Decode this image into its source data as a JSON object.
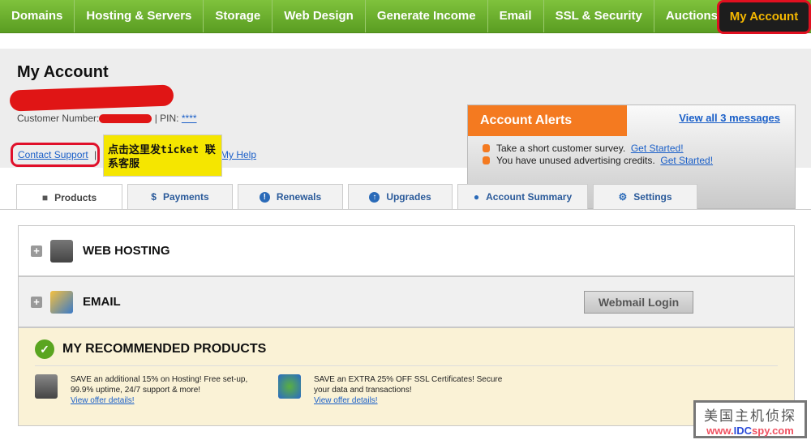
{
  "nav": {
    "items": [
      "Domains",
      "Hosting & Servers",
      "Storage",
      "Web Design",
      "Generate Income",
      "Email",
      "SSL & Security",
      "Auctions"
    ],
    "my_account": "My Account"
  },
  "header": {
    "title": "My Account",
    "customer_label": "Customer Number:",
    "pin_label": "PIN:",
    "pin_value": "****",
    "contact_support": "Contact Support",
    "my_help": "My Help",
    "annotation": "点击这里发ticket 联系客服"
  },
  "alerts": {
    "title": "Account Alerts",
    "view_all": "View all 3 messages",
    "items": [
      {
        "text": "Take a short customer survey.",
        "link": "Get Started!"
      },
      {
        "text": "You have unused advertising credits.",
        "link": "Get Started!"
      }
    ]
  },
  "tabs": [
    {
      "label": "Products",
      "icon": "cube-icon"
    },
    {
      "label": "Payments",
      "icon": "dollar-icon"
    },
    {
      "label": "Renewals",
      "icon": "alert-icon"
    },
    {
      "label": "Upgrades",
      "icon": "arrow-up-icon"
    },
    {
      "label": "Account Summary",
      "icon": "user-icon"
    },
    {
      "label": "Settings",
      "icon": "gear-icon"
    }
  ],
  "products": {
    "web_hosting": "WEB HOSTING",
    "email": "EMAIL",
    "webmail_login": "Webmail Login"
  },
  "recommended": {
    "title": "MY RECOMMENDED PRODUCTS",
    "offers": [
      {
        "text": "SAVE an additional 15% on Hosting! Free set-up, 99.9% uptime, 24/7 support & more!",
        "link": "View offer details!"
      },
      {
        "text": "SAVE an EXTRA 25% OFF SSL Certificates! Secure your data and transactions!",
        "link": "View offer details!"
      }
    ]
  },
  "watermark": {
    "line1": "美国主机侦探",
    "line2a": "www.",
    "line2b": "IDC",
    "line2c": "spy.com"
  }
}
